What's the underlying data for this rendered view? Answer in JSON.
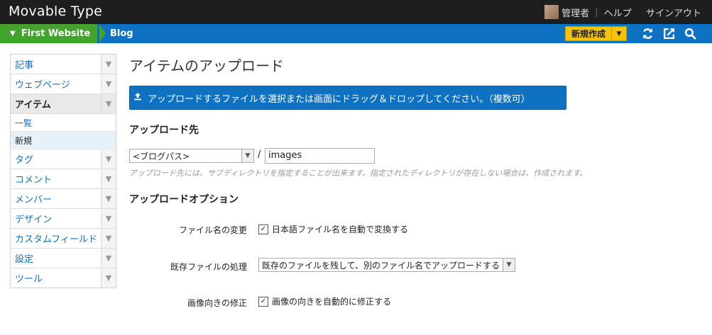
{
  "header": {
    "brand": "Movable Type",
    "user": "管理者",
    "help": "ヘルプ",
    "signout": "サインアウト"
  },
  "nav": {
    "site": "First Website",
    "blog": "Blog",
    "new_button": "新規作成",
    "icons": [
      "refresh-icon",
      "external-link-icon",
      "search-icon"
    ]
  },
  "sidebar": {
    "items": [
      {
        "label": "記事"
      },
      {
        "label": "ウェブページ"
      },
      {
        "label": "アイテム"
      },
      {
        "label": "タグ"
      },
      {
        "label": "コメント"
      },
      {
        "label": "メンバー"
      },
      {
        "label": "デザイン"
      },
      {
        "label": "カスタムフィールド"
      },
      {
        "label": "設定"
      },
      {
        "label": "ツール"
      }
    ],
    "subitems": [
      {
        "label": "一覧"
      },
      {
        "label": "新規"
      }
    ]
  },
  "main": {
    "title": "アイテムのアップロード",
    "upload_button": "アップロードするファイルを選択または画面にドラッグ＆ドロップしてください。（複数可）",
    "dest_heading": "アップロード先",
    "dest_select": "<ブログパス>",
    "dest_path": "images",
    "dest_hint": "アップロード先には、サブディレクトリを指定することが出来ます。指定されたディレクトリが存在しない場合は、作成されます。",
    "options_heading": "アップロードオプション",
    "filename_label": "ファイル名の変更",
    "filename_check": "日本語ファイル名を自動で変換する",
    "existing_label": "既存ファイルの処理",
    "existing_select": "既存のファイルを残して、別のファイル名でアップロードする",
    "orient_label": "画像向きの修正",
    "orient_check": "画像の向きを自動的に修正する"
  },
  "colors": {
    "topbar": "#1e1e1e",
    "nav": "#0f71c1",
    "site": "#43a42d",
    "new_button": "#f6c300"
  }
}
